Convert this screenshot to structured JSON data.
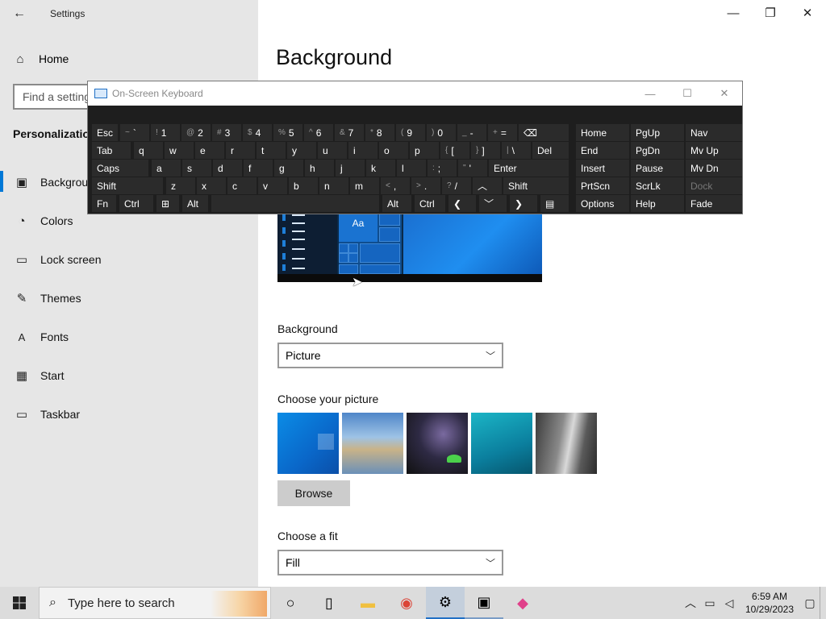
{
  "window": {
    "title": "Settings",
    "back_icon": "back-arrow-icon",
    "minimize": "—",
    "maximize": "❐",
    "close": "✕"
  },
  "sidebar": {
    "home_label": "Home",
    "search_placeholder": "Find a setting",
    "section_title": "Personalization",
    "items": [
      {
        "label": "Background",
        "icon": "image-icon"
      },
      {
        "label": "Colors",
        "icon": "palette-icon"
      },
      {
        "label": "Lock screen",
        "icon": "lock-screen-icon"
      },
      {
        "label": "Themes",
        "icon": "brush-icon"
      },
      {
        "label": "Fonts",
        "icon": "font-icon"
      },
      {
        "label": "Start",
        "icon": "start-icon"
      },
      {
        "label": "Taskbar",
        "icon": "taskbar-icon"
      }
    ]
  },
  "main": {
    "title": "Background",
    "preview_tile_text": "Aa",
    "background_label": "Background",
    "background_value": "Picture",
    "choose_picture_label": "Choose your picture",
    "browse_label": "Browse",
    "choose_fit_label": "Choose a fit",
    "fit_value": "Fill"
  },
  "osk": {
    "title": "On-Screen Keyboard",
    "rows": {
      "r1": [
        {
          "label": "Esc"
        },
        {
          "sup": "~",
          "label": "`"
        },
        {
          "sup": "!",
          "label": "1"
        },
        {
          "sup": "@",
          "label": "2"
        },
        {
          "sup": "#",
          "label": "3"
        },
        {
          "sup": "$",
          "label": "4"
        },
        {
          "sup": "%",
          "label": "5"
        },
        {
          "sup": "^",
          "label": "6"
        },
        {
          "sup": "&",
          "label": "7"
        },
        {
          "sup": "*",
          "label": "8"
        },
        {
          "sup": "(",
          "label": "9"
        },
        {
          "sup": ")",
          "label": "0"
        },
        {
          "sup": "_",
          "label": "-"
        },
        {
          "sup": "+",
          "label": "="
        },
        {
          "label": "⌫"
        }
      ],
      "r2": [
        {
          "label": "Tab"
        },
        {
          "label": "q"
        },
        {
          "label": "w"
        },
        {
          "label": "e"
        },
        {
          "label": "r"
        },
        {
          "label": "t"
        },
        {
          "label": "y"
        },
        {
          "label": "u"
        },
        {
          "label": "i"
        },
        {
          "label": "o"
        },
        {
          "label": "p"
        },
        {
          "sup": "{",
          "label": "["
        },
        {
          "sup": "}",
          "label": "]"
        },
        {
          "sup": "|",
          "label": "\\"
        },
        {
          "label": "Del"
        }
      ],
      "r3": [
        {
          "label": "Caps"
        },
        {
          "label": "a"
        },
        {
          "label": "s"
        },
        {
          "label": "d"
        },
        {
          "label": "f"
        },
        {
          "label": "g"
        },
        {
          "label": "h"
        },
        {
          "label": "j"
        },
        {
          "label": "k"
        },
        {
          "label": "l"
        },
        {
          "sup": ":",
          "label": ";"
        },
        {
          "sup": "\"",
          "label": "'"
        },
        {
          "label": "Enter"
        }
      ],
      "r4": [
        {
          "label": "Shift"
        },
        {
          "label": "z"
        },
        {
          "label": "x"
        },
        {
          "label": "c"
        },
        {
          "label": "v"
        },
        {
          "label": "b"
        },
        {
          "label": "n"
        },
        {
          "label": "m"
        },
        {
          "sup": "<",
          "label": ","
        },
        {
          "sup": ">",
          "label": "."
        },
        {
          "sup": "?",
          "label": "/"
        },
        {
          "label": "︿"
        },
        {
          "label": "Shift"
        }
      ],
      "r5": [
        {
          "label": "Fn"
        },
        {
          "label": "Ctrl"
        },
        {
          "label": "⊞"
        },
        {
          "label": "Alt"
        },
        {
          "label": ""
        },
        {
          "label": "Alt"
        },
        {
          "label": "Ctrl"
        },
        {
          "label": "❮"
        },
        {
          "label": "﹀"
        },
        {
          "label": "❯"
        },
        {
          "label": "▤"
        }
      ]
    },
    "side": [
      [
        "Home",
        "PgUp",
        "Nav"
      ],
      [
        "End",
        "PgDn",
        "Mv Up"
      ],
      [
        "Insert",
        "Pause",
        "Mv Dn"
      ],
      [
        "PrtScn",
        "ScrLk",
        "Dock"
      ],
      [
        "Options",
        "Help",
        "Fade"
      ]
    ]
  },
  "taskbar": {
    "search_placeholder": "Type here to search",
    "time": "6:59 AM",
    "date": "10/29/2023",
    "apps": [
      {
        "name": "cortana-icon",
        "glyph": "○",
        "state": ""
      },
      {
        "name": "task-view-icon",
        "glyph": "▯",
        "state": ""
      },
      {
        "name": "file-explorer-icon",
        "glyph": "▬",
        "state": ""
      },
      {
        "name": "chrome-icon",
        "glyph": "◉",
        "state": ""
      },
      {
        "name": "settings-gear-icon",
        "glyph": "⚙",
        "state": "active"
      },
      {
        "name": "remote-desktop-icon",
        "glyph": "▣",
        "state": "running"
      },
      {
        "name": "paint-icon",
        "glyph": "◆",
        "state": ""
      }
    ],
    "colors": {
      "chrome": "#db4437",
      "explorer": "#f0c040",
      "paint": "#e0408a"
    }
  }
}
